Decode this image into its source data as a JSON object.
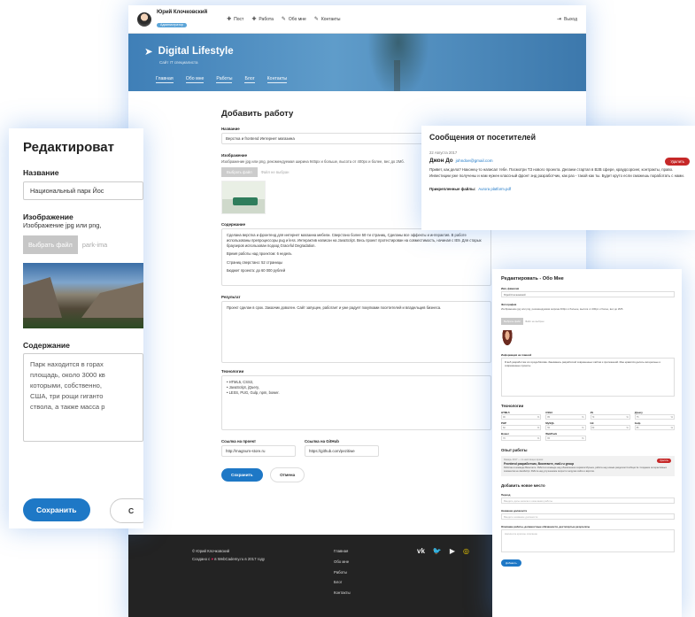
{
  "main": {
    "user": {
      "name": "Юрий Клочковский",
      "badge": "Администратор"
    },
    "topnav": [
      {
        "icon": "plus-icon",
        "label": "Пост"
      },
      {
        "icon": "plus-icon",
        "label": "Работа"
      },
      {
        "icon": "edit-icon",
        "label": "Обо мне"
      },
      {
        "icon": "edit-icon",
        "label": "Контакты"
      }
    ],
    "logout": "Выход",
    "site_title": "Digital Lifestyle",
    "site_subtitle": "Сайт IT специалиста",
    "nav": [
      "Главная",
      "Обо мне",
      "Работы",
      "Блог",
      "Контакты"
    ],
    "form": {
      "heading": "Добавить работу",
      "name_label": "Название",
      "name_value": "Верстка и frontend Интернет магазина",
      "image_label": "Изображение",
      "image_hint": "Изображение jpg или png, рекомендуемая ширина 945px и больше, высота от 400px и более, вес до 2Мб.",
      "file_button": "Выбрать файл",
      "file_name": "Файл не выбран",
      "content_label": "Содержание",
      "content_paragraphs": [
        "Сделана верстка и фронтенд для интернет магазина мебели. Сверстано более 50-ти страниц. Сделаны все эффекты и интерактив. В работе использованы препроцессоры pug и less. Интерактив написан на JavaScript. Весь проект протестирован на совместимость, начиная с IE9. Для старых браузеров использован подход Graceful Degradation.",
        "Время работы над проектом: 6 недель",
        "Страниц сверстано: 52 страницы",
        "Бюджет проекта: до 60 000 рублей"
      ],
      "result_label": "Результат",
      "result_text": "Проект сделан в срок. Заказчик доволен. Сайт запущен, работает и уже радует покупками посетителей и владельцев бизнеса.",
      "tech_label": "Технологии",
      "tech_lines": [
        "• HTML5, CSS3,",
        "• JavaScript, jQuery,",
        "• LESS, PUG, Gulp, npm, bower."
      ],
      "project_label": "Ссылка на проект",
      "project_value": "http://magnum-store.ru",
      "github_label": "Ссылка на GitHub",
      "github_value": "https://github.com/pezitiwe",
      "save": "Сохранить",
      "cancel": "Отмена"
    },
    "footer": {
      "copyright": "© Юрий Клочковский",
      "created_prefix": "Создано с",
      "created_suffix": "в WebCademy.ru в 2017 году",
      "links": [
        "Главная",
        "Обо мне",
        "Работы",
        "Блог",
        "Контакты"
      ],
      "social": [
        {
          "icon": "vk-icon",
          "glyph": "vk"
        },
        {
          "icon": "twitter-icon",
          "glyph": "🐦"
        },
        {
          "icon": "youtube-icon",
          "glyph": "▶"
        },
        {
          "icon": "instagram-icon",
          "glyph": "◎"
        }
      ]
    }
  },
  "left_editor": {
    "heading": "Редактироват",
    "name_label": "Название",
    "name_value": "Национальный парк Йос",
    "image_label": "Изображение",
    "image_hint": "Изображение jpg или png,",
    "file_button": "Выбрать файл",
    "file_name": "park-ima",
    "content_label": "Содержание",
    "content_lines": [
      "Парк находится в горах",
      "площадь, около 3000 кв",
      "которыми, собственно,",
      "США, три рощи гиганто",
      "ствола, а также масса р"
    ],
    "save": "Сохранить",
    "cancel": "С"
  },
  "messages": {
    "heading": "Сообщения от посетителей",
    "date": "22 Августа 2017",
    "delete": "Удалить",
    "sender_name": "Джон До",
    "sender_email": "johndoe@gmail.com",
    "text": "Привет, как дела? Наконец-то написал тебе. Посмотри ТЗ нового проекта. Делаем стартап в B2B сфере, краудсорсинг, контракты, право. Инвестиции уже получены и нам нужен классный фронт энд разработчик, как раз - такой как ты. Будет круто если сможешь поработать с нами.",
    "attach_label": "Прикрепленные файлы:",
    "attach_file": "Aurora platform.pdf"
  },
  "about": {
    "heading": "Редактировать - Обо Мне",
    "name_label": "Имя, фамилия",
    "name_value": "Юрий Клочковский",
    "photo_label": "Фотография",
    "photo_hint": "Изображение jpg или png, рекомендуемая ширина 400px и больше, высота от 400px и более, вес до 2Мб.",
    "file_button": "Выбрать файл",
    "file_name": "Файл не выбран",
    "info_label": "Информация на главной",
    "info_text": "Я веб разработчик из города Москва. Занимаюсь разработкой современных сайтов и приложений. Мне нравится делать интересные и современные проекты.",
    "tech_heading": "Технологии",
    "tech_items": [
      {
        "label": "HTML5",
        "value": "90"
      },
      {
        "label": "CSS3",
        "value": "85"
      },
      {
        "label": "JS",
        "value": "70"
      },
      {
        "label": "jQuery",
        "value": "75"
      },
      {
        "label": "PHP",
        "value": "60"
      },
      {
        "label": "MySQL",
        "value": "55"
      },
      {
        "label": "Git",
        "value": "80"
      },
      {
        "label": "Gulp",
        "value": "85"
      },
      {
        "label": "Bower",
        "value": "70"
      },
      {
        "label": "WebPack",
        "value": "65"
      }
    ],
    "exp_heading": "Опыт работы",
    "job_date": "Январь 2017 — по настоящее время",
    "job_title": "Frontend разработчик, Вконтакте, mail.ru group",
    "job_text": "Работаю в команде Вконтакте. Работа в команде над обновлением сервиса Музыка, работа над новым разделом Сообществ. Создание интерактивных элементов на JavaScript. Работа над улучшением скорости загрузки сайта и вёрстки.",
    "job_delete": "Удалить",
    "add_heading": "Добавить новое место",
    "period_label": "Период",
    "period_placeholder": "Введите даты начала и окончания работы",
    "position_label": "Название должности",
    "position_placeholder": "Введите название должности",
    "duties_label": "Описание работы, должностные обязанности, достигнутые результаты",
    "duties_placeholder": "Напишите краткое описание",
    "add_button": "Добавить"
  }
}
